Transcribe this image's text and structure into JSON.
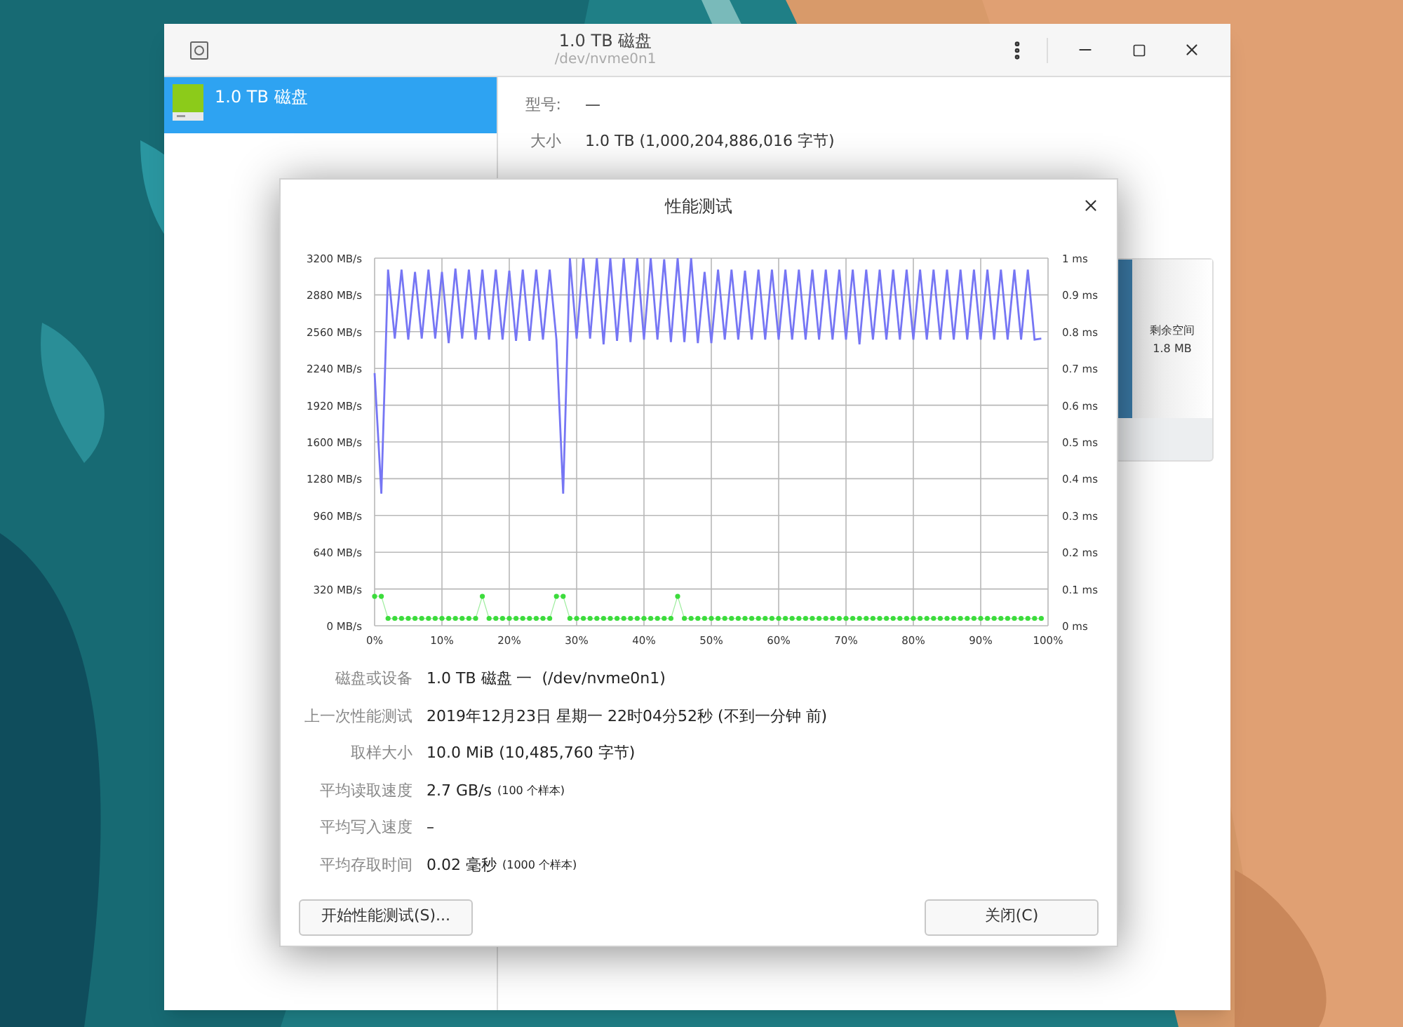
{
  "window": {
    "title": "1.0 TB 磁盘",
    "subtitle": "/dev/nvme0n1"
  },
  "sidebar": {
    "items": [
      {
        "label": "1.0 TB 磁盘",
        "selected": true
      }
    ]
  },
  "disk_info": [
    {
      "label": "型号:",
      "value": "—"
    },
    {
      "label": "大小",
      "value": "1.0 TB (1,000,204,886,016 字节)"
    }
  ],
  "partition_map": {
    "segments": [
      {
        "kind": "partition",
        "selected": true
      },
      {
        "kind": "free",
        "label": "剩余空间",
        "size": "1.8 MB",
        "selected": false
      }
    ]
  },
  "dialog": {
    "title": "性能测试",
    "chart_data": {
      "type": "line",
      "grid": true,
      "xlim": [
        0,
        100
      ],
      "ylim": [
        0,
        3200
      ],
      "y2lim": [
        0,
        1
      ],
      "x": [
        0,
        1,
        2,
        3,
        4,
        5,
        6,
        7,
        8,
        9,
        10,
        11,
        12,
        13,
        14,
        15,
        16,
        17,
        18,
        19,
        20,
        21,
        22,
        23,
        24,
        25,
        26,
        27,
        28,
        29,
        30,
        31,
        32,
        33,
        34,
        35,
        36,
        37,
        38,
        39,
        40,
        41,
        42,
        43,
        44,
        45,
        46,
        47,
        48,
        49,
        50,
        51,
        52,
        53,
        54,
        55,
        56,
        57,
        58,
        59,
        60,
        61,
        62,
        63,
        64,
        65,
        66,
        67,
        68,
        69,
        70,
        71,
        72,
        73,
        74,
        75,
        76,
        77,
        78,
        79,
        80,
        81,
        82,
        83,
        84,
        85,
        86,
        87,
        88,
        89,
        90,
        91,
        92,
        93,
        94,
        95,
        96,
        97,
        98,
        99
      ],
      "series": [
        {
          "color": "#7676f4",
          "values": [
            2200,
            1150,
            3100,
            2500,
            3100,
            2490,
            3080,
            2500,
            3100,
            2500,
            3080,
            2460,
            3110,
            2500,
            3100,
            2490,
            3100,
            2490,
            3100,
            2490,
            3090,
            2480,
            3100,
            2480,
            3100,
            2490,
            3100,
            2490,
            1150,
            3200,
            2500,
            3200,
            2500,
            3200,
            2450,
            3200,
            2480,
            3200,
            2470,
            3200,
            2490,
            3200,
            2490,
            3190,
            2470,
            3200,
            2470,
            3200,
            2460,
            3080,
            2460,
            3100,
            2490,
            3100,
            2490,
            3090,
            2490,
            3100,
            2490,
            3100,
            2490,
            3100,
            2490,
            3100,
            2490,
            3100,
            2490,
            3100,
            2490,
            3100,
            2490,
            3100,
            2450,
            3100,
            2490,
            3100,
            2490,
            3100,
            2490,
            3100,
            2490,
            3100,
            2490,
            3100,
            2490,
            3100,
            2490,
            3100,
            2490,
            3100,
            2490,
            3100,
            2490,
            3100,
            2490,
            3100,
            2490,
            3100,
            2490,
            2500
          ]
        },
        {
          "color": "#3cdc3c",
          "axis": "y2",
          "marker": "circle",
          "values": [
            0.08,
            0.08,
            0.02,
            0.02,
            0.02,
            0.02,
            0.02,
            0.02,
            0.02,
            0.02,
            0.02,
            0.02,
            0.02,
            0.02,
            0.02,
            0.02,
            0.08,
            0.02,
            0.02,
            0.02,
            0.02,
            0.02,
            0.02,
            0.02,
            0.02,
            0.02,
            0.02,
            0.08,
            0.08,
            0.02,
            0.02,
            0.02,
            0.02,
            0.02,
            0.02,
            0.02,
            0.02,
            0.02,
            0.02,
            0.02,
            0.02,
            0.02,
            0.02,
            0.02,
            0.02,
            0.08,
            0.02,
            0.02,
            0.02,
            0.02,
            0.02,
            0.02,
            0.02,
            0.02,
            0.02,
            0.02,
            0.02,
            0.02,
            0.02,
            0.02,
            0.02,
            0.02,
            0.02,
            0.02,
            0.02,
            0.02,
            0.02,
            0.02,
            0.02,
            0.02,
            0.02,
            0.02,
            0.02,
            0.02,
            0.02,
            0.02,
            0.02,
            0.02,
            0.02,
            0.02,
            0.02,
            0.02,
            0.02,
            0.02,
            0.02,
            0.02,
            0.02,
            0.02,
            0.02,
            0.02,
            0.02,
            0.02,
            0.02,
            0.02,
            0.02,
            0.02,
            0.02,
            0.02,
            0.02,
            0.02
          ]
        }
      ],
      "xticks": [
        {
          "value": 0,
          "label": "0%"
        },
        {
          "value": 10,
          "label": "10%"
        },
        {
          "value": 20,
          "label": "20%"
        },
        {
          "value": 30,
          "label": "30%"
        },
        {
          "value": 40,
          "label": "40%"
        },
        {
          "value": 50,
          "label": "50%"
        },
        {
          "value": 60,
          "label": "60%"
        },
        {
          "value": 70,
          "label": "70%"
        },
        {
          "value": 80,
          "label": "80%"
        },
        {
          "value": 90,
          "label": "90%"
        },
        {
          "value": 100,
          "label": "100%"
        }
      ],
      "yticks": [
        {
          "value": 0,
          "label": "0 MB/s"
        },
        {
          "value": 320,
          "label": "320 MB/s"
        },
        {
          "value": 640,
          "label": "640 MB/s"
        },
        {
          "value": 960,
          "label": "960 MB/s"
        },
        {
          "value": 1280,
          "label": "1280 MB/s"
        },
        {
          "value": 1600,
          "label": "1600 MB/s"
        },
        {
          "value": 1920,
          "label": "1920 MB/s"
        },
        {
          "value": 2240,
          "label": "2240 MB/s"
        },
        {
          "value": 2560,
          "label": "2560 MB/s"
        },
        {
          "value": 2880,
          "label": "2880 MB/s"
        },
        {
          "value": 3200,
          "label": "3200 MB/s"
        }
      ],
      "y2ticks": [
        {
          "value": 0,
          "label": "0 ms"
        },
        {
          "value": 0.1,
          "label": "0.1 ms"
        },
        {
          "value": 0.2,
          "label": "0.2 ms"
        },
        {
          "value": 0.3,
          "label": "0.3 ms"
        },
        {
          "value": 0.4,
          "label": "0.4 ms"
        },
        {
          "value": 0.5,
          "label": "0.5 ms"
        },
        {
          "value": 0.6,
          "label": "0.6 ms"
        },
        {
          "value": 0.7,
          "label": "0.7 ms"
        },
        {
          "value": 0.8,
          "label": "0.8 ms"
        },
        {
          "value": 0.9,
          "label": "0.9 ms"
        },
        {
          "value": 1,
          "label": "1 ms"
        }
      ]
    },
    "stats": [
      {
        "label": "磁盘或设备",
        "value": "1.0 TB 磁盘 一  (/dev/nvme0n1)"
      },
      {
        "label": "上一次性能测试",
        "value": "2019年12月23日 星期一 22时04分52秒 (不到一分钟 前)"
      },
      {
        "label": "取样大小",
        "value": "10.0 MiB (10,485,760 字节)"
      },
      {
        "label": "平均读取速度",
        "value": "2.7 GB/s",
        "note": "(100 个样本)"
      },
      {
        "label": "平均写入速度",
        "value": "–"
      },
      {
        "label": "平均存取时间",
        "value": "0.02 毫秒",
        "note": "(1000 个样本)"
      }
    ],
    "buttons": [
      "开始性能测试(S)...",
      "关闭(C)"
    ]
  }
}
